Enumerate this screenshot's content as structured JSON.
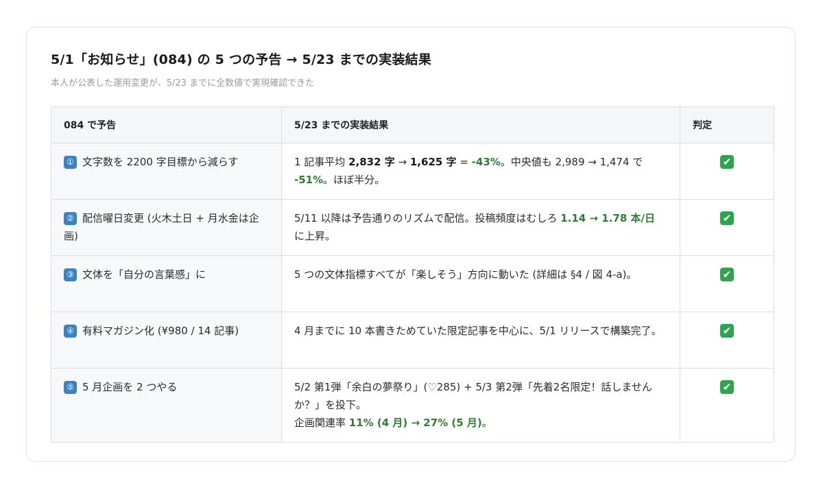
{
  "title": "5/1「お知らせ」(084) の 5 つの予告 → 5/23 までの実装結果",
  "subtitle": "本人が公表した運用変更が、5/23 までに全数値で実現確認できた",
  "headers": {
    "prediction": "084 で予告",
    "result": "5/23 までの実装結果",
    "verdict": "判定"
  },
  "verdict_icon": "check-mark-icon",
  "check_glyph": "✔",
  "accent_color": "#3b82c4",
  "positive_color": "#2e7d32",
  "rows": [
    {
      "num": "①",
      "prediction": "文字数を 2200 字目標から減らす",
      "result": {
        "t1": "1 記事平均 ",
        "b1": "2,832 字",
        "t2": " → ",
        "b2": "1,625 字",
        "t3": " = ",
        "g1": "-43%",
        "t4": "。中央値も 2,989 → 1,474 で ",
        "g2": "-51%",
        "t5": "。ほぼ半分。"
      }
    },
    {
      "num": "②",
      "prediction": "配信曜日変更 (火木土日 + 月水金は企画)",
      "result": {
        "t1": "5/11 以降は予告通りのリズムで配信。投稿頻度はむしろ ",
        "g1": "1.14 → 1.78 本/日",
        "t2": " に上昇。"
      }
    },
    {
      "num": "③",
      "prediction": "文体を「自分の言葉感」に",
      "result": {
        "t1": "5 つの文体指標すべてが「楽しそう」方向に動いた (詳細は §4 / 図 4-a)。"
      }
    },
    {
      "num": "④",
      "prediction": "有料マガジン化 (¥980 / 14 記事)",
      "result": {
        "t1": "4 月までに 10 本書きためていた限定記事を中心に、5/1 リリースで構築完了。"
      }
    },
    {
      "num": "⑤",
      "prediction": "5 月企画を 2 つやる",
      "result": {
        "t1": "5/2 第1弾「余白の夢祭り」(♡285) + 5/3 第2弾「先着2名限定！話しませんか？」を投下。",
        "t2": "企画関連率 ",
        "g1": "11% (4 月) → 27% (5 月)",
        "t3": "。"
      }
    }
  ]
}
